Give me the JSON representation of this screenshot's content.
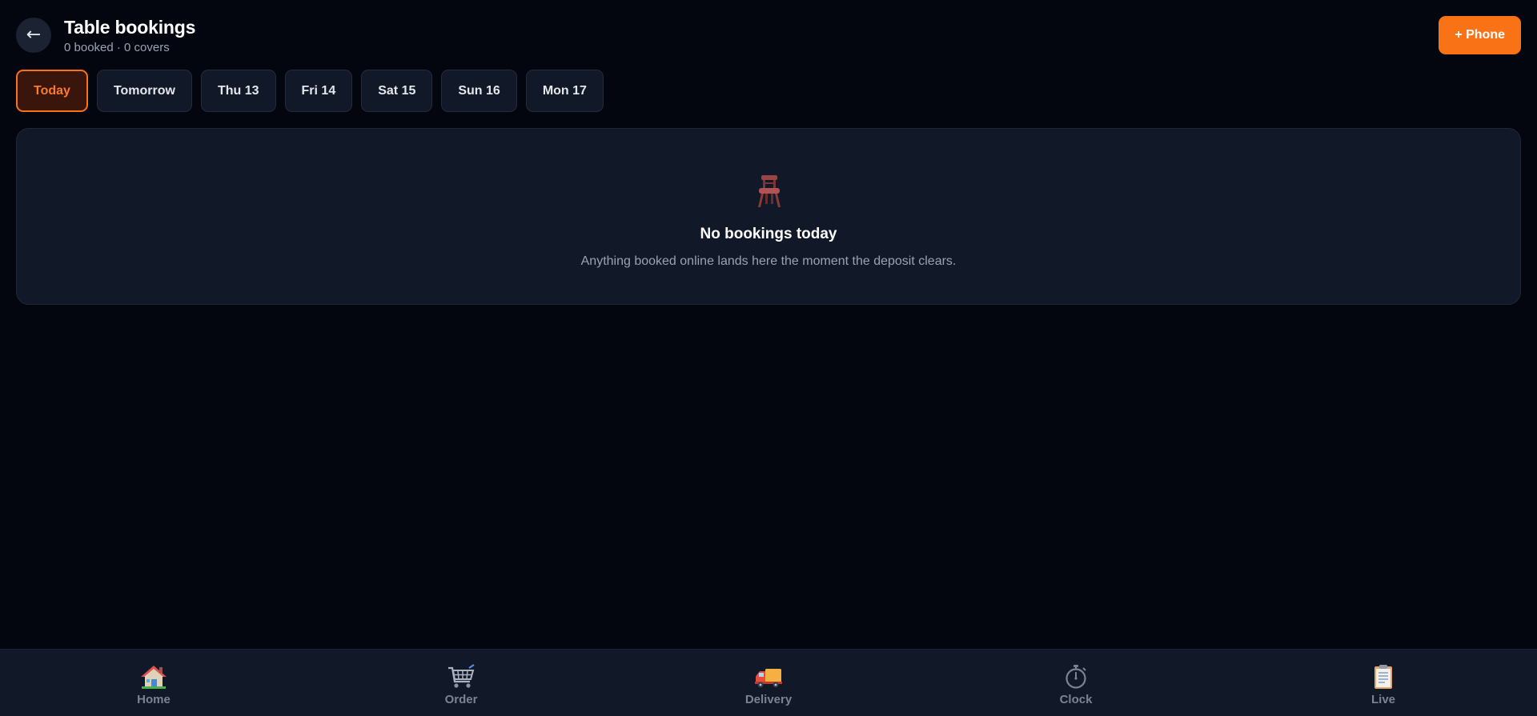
{
  "header": {
    "back_label": "←",
    "title": "Table bookings",
    "subtitle": "0 booked · 0 covers",
    "phone_label": "+ Phone"
  },
  "day_tabs": [
    {
      "label": "Today",
      "active": true
    },
    {
      "label": "Tomorrow",
      "active": false
    },
    {
      "label": "Thu 13",
      "active": false
    },
    {
      "label": "Fri 14",
      "active": false
    },
    {
      "label": "Sat 15",
      "active": false
    },
    {
      "label": "Sun 16",
      "active": false
    },
    {
      "label": "Mon 17",
      "active": false
    }
  ],
  "empty_state": {
    "icon": "chair-icon",
    "title": "No bookings today",
    "description": "Anything booked online lands here the moment the deposit clears."
  },
  "bottom_nav": [
    {
      "label": "Home",
      "icon": "house-icon"
    },
    {
      "label": "Order",
      "icon": "shopping-cart-icon"
    },
    {
      "label": "Delivery",
      "icon": "delivery-truck-icon"
    },
    {
      "label": "Clock",
      "icon": "stopwatch-icon"
    },
    {
      "label": "Live",
      "icon": "clipboard-icon"
    }
  ],
  "colors": {
    "background": "#03060f",
    "surface": "#111827",
    "accent": "#f97316",
    "muted_text": "#9aa3b3",
    "nav_label": "#7b8494"
  }
}
